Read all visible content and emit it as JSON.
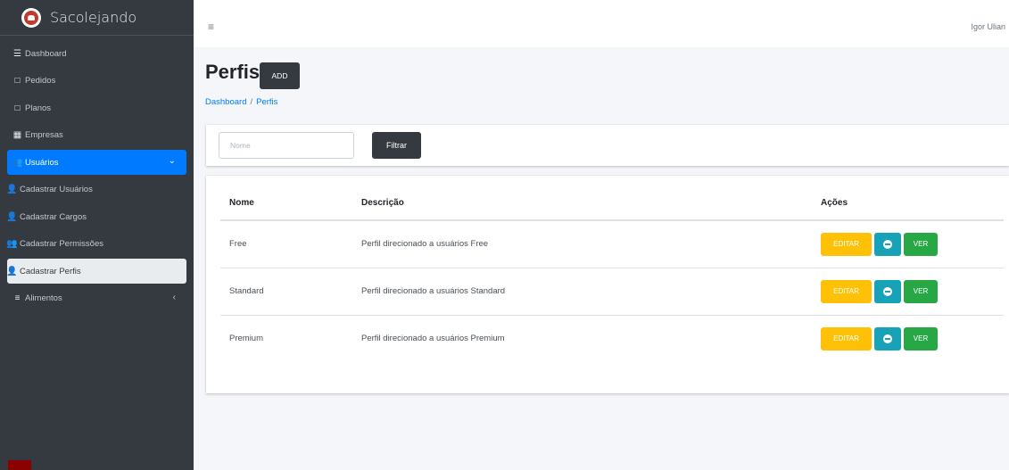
{
  "brand": {
    "name": "Sacolejando"
  },
  "sidebar": {
    "items": [
      {
        "label": "Dashboard",
        "icon": "menu-icon"
      },
      {
        "label": "Pedidos",
        "icon": "calendar-icon"
      },
      {
        "label": "Planos",
        "icon": "calendar-icon"
      },
      {
        "label": "Empresas",
        "icon": "building-icon"
      },
      {
        "label": "Usuários",
        "icon": "users-icon"
      },
      {
        "label": "Cadastrar Usuários",
        "icon": "user-plus-icon"
      },
      {
        "label": "Cadastrar Cargos",
        "icon": "user-tag-icon"
      },
      {
        "label": "Cadastrar Permissões",
        "icon": "users-cog-icon"
      },
      {
        "label": "Cadastrar Perfis",
        "icon": "user-tag-icon"
      },
      {
        "label": "Alimentos",
        "icon": "hamburger-icon"
      }
    ]
  },
  "topbar": {
    "user_name": "Igor Ulian"
  },
  "page": {
    "title": "Perfis",
    "add_label": "ADD",
    "breadcrumb": [
      "Dashboard",
      "Perfis"
    ]
  },
  "filter": {
    "placeholder": "Nome",
    "button_label": "Filtrar"
  },
  "table": {
    "headers": [
      "Nome",
      "Descrição",
      "Ações"
    ],
    "rows": [
      {
        "nome": "Free",
        "descricao": "Perfil direcionado a usuários Free"
      },
      {
        "nome": "Standard",
        "descricao": "Perfil direcionado a usuários Standard"
      },
      {
        "nome": "Premium",
        "descricao": "Perfil direcionado a usuários Premium"
      }
    ],
    "actions": {
      "edit": "EDITAR",
      "view": "VER"
    }
  },
  "colors": {
    "sidebar_bg": "#343a40",
    "active_blue": "#007bff",
    "edit_yellow": "#ffc107",
    "delete_teal": "#17a2b8",
    "view_green": "#28a745"
  }
}
